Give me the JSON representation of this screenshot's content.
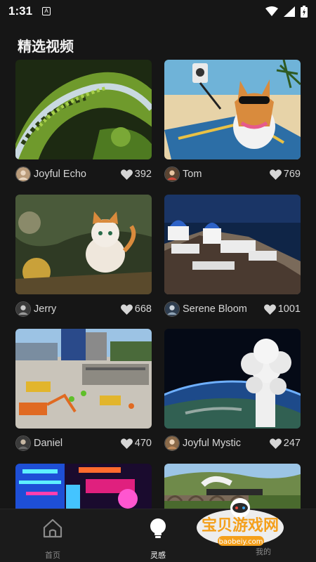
{
  "status": {
    "time": "1:31",
    "app_icon": "A"
  },
  "page": {
    "title": "精选视频"
  },
  "cards": [
    {
      "author": "Joyful Echo",
      "likes": "392",
      "thumb": "chameleon"
    },
    {
      "author": "Tom",
      "likes": "769",
      "thumb": "corgi-beach"
    },
    {
      "author": "Jerry",
      "likes": "668",
      "thumb": "cat-garden"
    },
    {
      "author": "Serene Bloom",
      "likes": "1001",
      "thumb": "santorini"
    },
    {
      "author": "Daniel",
      "likes": "470",
      "thumb": "construction"
    },
    {
      "author": "Joyful Mystic",
      "likes": "247",
      "thumb": "earth-cloud"
    },
    {
      "author": "",
      "likes": "",
      "thumb": "neon-city"
    },
    {
      "author": "",
      "likes": "",
      "thumb": "train-valley"
    }
  ],
  "tabbar": {
    "home_label": "首页",
    "inspire_label": "灵感",
    "third_label": "我的"
  },
  "watermark": {
    "brand": "宝贝游戏网",
    "url": "baobeiy.com"
  },
  "colors": {
    "background": "#161616",
    "text": "#e8e8e8",
    "tab_active": "#ffffff",
    "tab_inactive": "#8a8a8a"
  }
}
